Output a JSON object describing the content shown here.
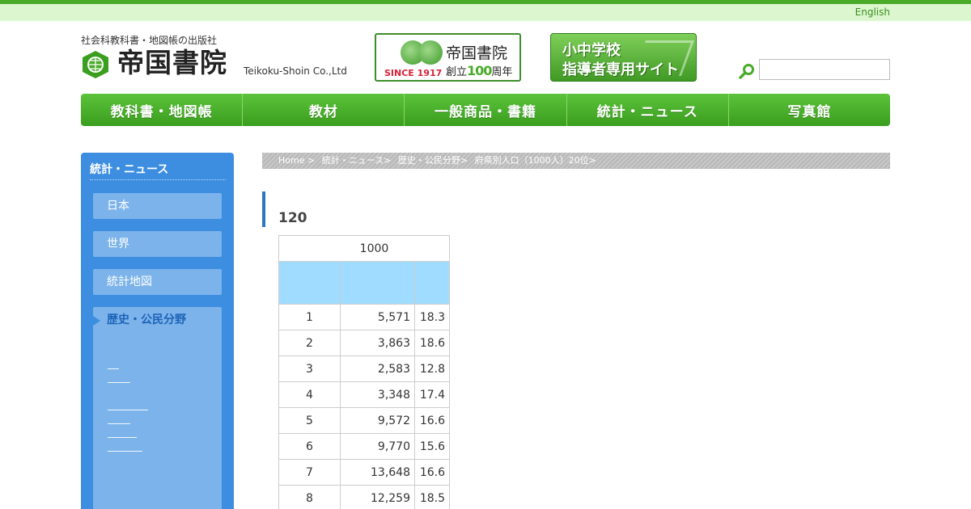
{
  "header": {
    "lang_link": "English",
    "tagline": "社会科教科書・地図帳の出版社",
    "logo_text": "帝国書院",
    "logo_en": "Teikoku-Shoin Co.,Ltd",
    "banner_anniversary": {
      "since": "SINCE 1917",
      "name": "帝国書院",
      "sub_prefix": "創立",
      "sub_number": "100",
      "sub_suffix": "周年"
    },
    "banner_teacher": {
      "line1": "小中学校",
      "line2": "指導者専用サイト"
    },
    "search": {
      "placeholder": ""
    }
  },
  "nav": {
    "items": [
      "教科書・地図帳",
      "教材",
      "一般商品・書籍",
      "統計・ニュース",
      "写真館"
    ]
  },
  "sidebar": {
    "title": "統計・ニュース",
    "items": [
      "日本",
      "世界",
      "統計地図",
      "歴史・公民分野"
    ]
  },
  "breadcrumb": [
    "Home >",
    "統計・ニュース>",
    "歴史・公民分野>",
    "府県別人口（1000人）20位>"
  ],
  "content": {
    "heading": "120",
    "table": {
      "caption": "1000",
      "rows": [
        [
          "1",
          "5,571",
          "18.3"
        ],
        [
          "2",
          "3,863",
          "18.6"
        ],
        [
          "3",
          "2,583",
          "12.8"
        ],
        [
          "4",
          "3,348",
          "17.4"
        ],
        [
          "5",
          "9,572",
          "16.6"
        ],
        [
          "6",
          "9,770",
          "15.6"
        ],
        [
          "7",
          "13,648",
          "16.6"
        ],
        [
          "8",
          "12,259",
          "18.5"
        ]
      ]
    }
  },
  "colors": {
    "brand_green": "#4aab2a",
    "sidebar_blue": "#3d8de0",
    "table_header": "#9fdcff"
  }
}
